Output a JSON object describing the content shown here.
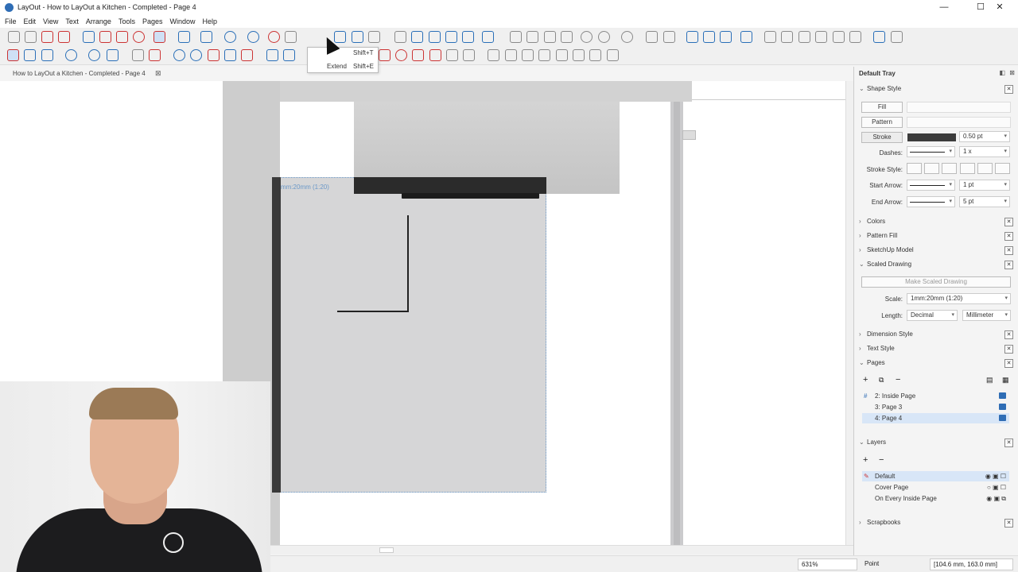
{
  "window": {
    "title": "LayOut - How to LayOut a Kitchen - Completed - Page 4",
    "minimize": "—",
    "maximize": "☐",
    "close": "✕"
  },
  "menu": [
    "File",
    "Edit",
    "View",
    "Text",
    "Arrange",
    "Tools",
    "Pages",
    "Window",
    "Help"
  ],
  "document_tab": {
    "label": "How to LayOut a Kitchen - Completed - Page 4",
    "close": "⊠"
  },
  "popup": {
    "items": [
      {
        "label": "",
        "shortcut": "Shift+T"
      },
      {
        "label": "Extend",
        "shortcut": "Shift+E"
      }
    ]
  },
  "canvas": {
    "viewport_label": "mm:20mm (1:20)"
  },
  "tray": {
    "title": "Default Tray",
    "shape_style": {
      "heading": "Shape Style",
      "fill_label": "Fill",
      "pattern_label": "Pattern",
      "stroke_label": "Stroke",
      "stroke_width": "0.50 pt",
      "dashes_label": "Dashes:",
      "dashes_scale": "1 x",
      "stroke_style_label": "Stroke Style:",
      "start_arrow_label": "Start Arrow:",
      "start_arrow_size": "1 pt",
      "end_arrow_label": "End Arrow:",
      "end_arrow_size": "5 pt"
    },
    "colors": "Colors",
    "pattern_fill": "Pattern Fill",
    "sketchup_model": "SketchUp Model",
    "scaled_drawing": {
      "heading": "Scaled Drawing",
      "make_button": "Make Scaled Drawing",
      "scale_label": "Scale:",
      "scale_value": "1mm:20mm (1:20)",
      "length_label": "Length:",
      "length_format": "Decimal",
      "length_unit": "Millimeter"
    },
    "dimension_style": "Dimension Style",
    "text_style": "Text Style",
    "pages": {
      "heading": "Pages",
      "items": [
        {
          "label": "2: Inside Page",
          "selected": false
        },
        {
          "label": "3: Page 3",
          "selected": false
        },
        {
          "label": "4: Page 4",
          "selected": true
        }
      ]
    },
    "layers": {
      "heading": "Layers",
      "items": [
        {
          "label": "Default",
          "selected": true
        },
        {
          "label": "Cover Page",
          "selected": false
        },
        {
          "label": "On Every Inside Page",
          "selected": false
        }
      ]
    },
    "scrapbooks": "Scrapbooks"
  },
  "status": {
    "zoom": "631%",
    "mode": "Point",
    "coords": "[104.6 mm, 163.0 mm]"
  },
  "colors": {
    "accent": "#2f6db5",
    "tool_red": "#cc3333",
    "viewport_border": "#6a98c8"
  }
}
